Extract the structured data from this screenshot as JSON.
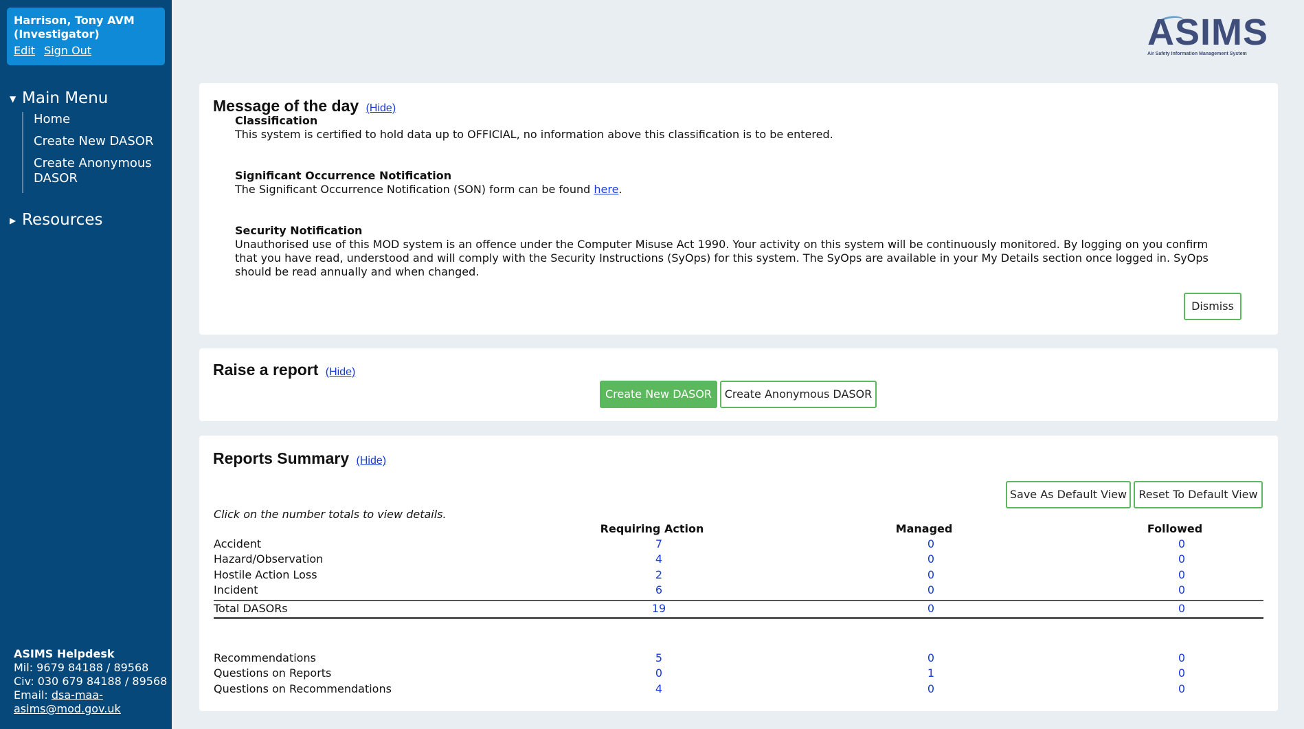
{
  "user": {
    "name": "Harrison, Tony AVM",
    "role": "(Investigator)",
    "edit_label": "Edit",
    "signout_label": "Sign Out"
  },
  "sidebar": {
    "main_menu_label": "Main Menu",
    "main_menu_expanded": true,
    "items": [
      {
        "label": "Home"
      },
      {
        "label": "Create New DASOR"
      },
      {
        "label": "Create Anonymous DASOR"
      }
    ],
    "resources_label": "Resources",
    "resources_expanded": false
  },
  "helpdesk": {
    "title": "ASIMS Helpdesk",
    "mil": "Mil: 9679 84188 / 89568",
    "civ": "Civ: 030 679 84188 / 89568",
    "email_prefix": "Email: ",
    "email": "dsa-maa-asims@mod.gov.uk"
  },
  "logo": {
    "text": "ASIMS",
    "subtitle": "Air Safety Information Management System"
  },
  "motd": {
    "title": "Message of the day",
    "hide_label": "(Hide)",
    "classification_title": "Classification",
    "classification_text": "This system is certified to hold data up to OFFICIAL, no information above this classification is to be entered.",
    "son_title": "Significant Occurrence Notification",
    "son_text_before": "The Significant Occurrence Notification (SON) form can be found ",
    "son_link": "here",
    "son_text_after": ".",
    "security_title": "Security Notification",
    "security_text": "Unauthorised use of this MOD system is an offence under the Computer Misuse Act 1990. Your activity on this system will be continuously monitored. By logging on you confirm that you have read, understood and will comply with the Security Instructions (SyOps) for this system. The SyOps are available in your My Details section once logged in.  SyOps should be read annually and when changed.",
    "dismiss_label": "Dismiss"
  },
  "raise": {
    "title": "Raise a report",
    "hide_label": "(Hide)",
    "create_label": "Create New DASOR",
    "create_anon_label": "Create Anonymous DASOR"
  },
  "reports": {
    "title": "Reports Summary",
    "hide_label": "(Hide)",
    "save_default_label": "Save As Default View",
    "reset_default_label": "Reset To Default View",
    "hint": "Click on the number totals to view details.",
    "columns": [
      "Requiring Action",
      "Managed",
      "Followed"
    ],
    "rows": [
      {
        "label": "Accident",
        "values": [
          "7",
          "0",
          "0"
        ]
      },
      {
        "label": "Hazard/Observation",
        "values": [
          "4",
          "0",
          "0"
        ]
      },
      {
        "label": "Hostile Action Loss",
        "values": [
          "2",
          "0",
          "0"
        ]
      },
      {
        "label": "Incident",
        "values": [
          "6",
          "0",
          "0"
        ]
      }
    ],
    "total": {
      "label": "Total DASORs",
      "values": [
        "19",
        "0",
        "0"
      ]
    },
    "extra_rows": [
      {
        "label": "Recommendations",
        "values": [
          "5",
          "0",
          "0"
        ]
      },
      {
        "label": "Questions on Reports",
        "values": [
          "0",
          "1",
          "0"
        ]
      },
      {
        "label": "Questions on Recommendations",
        "values": [
          "4",
          "0",
          "0"
        ]
      }
    ]
  },
  "colors": {
    "sidebar_bg": "#06487a",
    "user_box_bg": "#0e8ad6",
    "page_bg": "#e9eef2",
    "button_green": "#5cb85c",
    "link_blue": "#1a3bd6"
  }
}
